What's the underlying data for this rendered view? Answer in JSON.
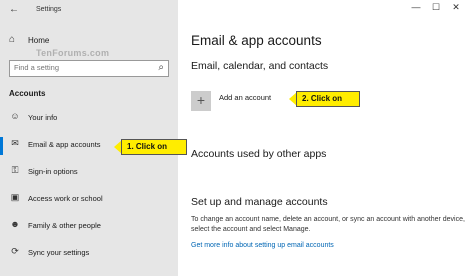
{
  "window": {
    "title": "Settings",
    "controls": {
      "minimize": "—",
      "maximize": "☐",
      "close": "✕"
    }
  },
  "sidebar": {
    "home_label": "Home",
    "search_placeholder": "Find a setting",
    "watermark": "TenForums.com",
    "section_title": "Accounts",
    "items": [
      {
        "label": "Your info",
        "icon": "person-icon",
        "glyph": "☺"
      },
      {
        "label": "Email & app accounts",
        "icon": "mail-icon",
        "glyph": "✉",
        "selected": true
      },
      {
        "label": "Sign-in options",
        "icon": "key-icon",
        "glyph": "⚿"
      },
      {
        "label": "Access work or school",
        "icon": "briefcase-icon",
        "glyph": "▣"
      },
      {
        "label": "Family & other people",
        "icon": "people-icon",
        "glyph": "☻"
      },
      {
        "label": "Sync your settings",
        "icon": "sync-icon",
        "glyph": "⟳"
      }
    ]
  },
  "main": {
    "title": "Email & app accounts",
    "section1": "Email, calendar, and contacts",
    "add_account_label": "Add an account",
    "section2": "Accounts used by other apps",
    "section3": "Set up and manage accounts",
    "paragraph": "To change an account name, delete an account, or sync an account with another device, select the account and select Manage.",
    "link": "Get more info about setting up email accounts"
  },
  "callouts": {
    "c1": "1. Click on",
    "c2": "2. Click on"
  },
  "colors": {
    "accent": "#0078d7",
    "callout": "#ffed00",
    "sidebar_bg": "#e6e6e6",
    "link": "#0066b4"
  }
}
